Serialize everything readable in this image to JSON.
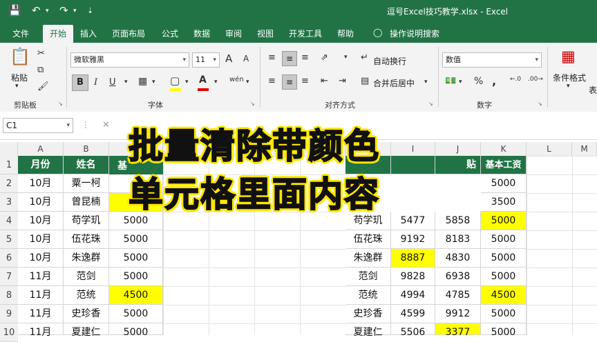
{
  "window": {
    "title": "逗号Excel技巧教学.xlsx  -  Excel"
  },
  "quick_access": {
    "save_icon": "save-icon",
    "undo_icon": "undo-icon",
    "redo_icon": "redo-icon"
  },
  "menu": {
    "items": [
      "文件",
      "开始",
      "插入",
      "页面布局",
      "公式",
      "数据",
      "审阅",
      "视图",
      "开发工具",
      "帮助"
    ],
    "active": "开始",
    "tell_me": "操作说明搜索"
  },
  "ribbon": {
    "clipboard": {
      "paste": "粘贴",
      "group": "剪贴板"
    },
    "font": {
      "name": "微软雅黑",
      "size": "11",
      "bold": "B",
      "italic": "I",
      "underline": "U",
      "group": "字体",
      "grow": "A",
      "shrink": "A",
      "phonetic": "wén",
      "font_color_mark": "A"
    },
    "alignment": {
      "wrap": "自动换行",
      "merge": "合并后居中",
      "group": "对齐方式"
    },
    "number": {
      "format": "数值",
      "percent": "%",
      "comma": ",",
      "group": "数字"
    },
    "styles": {
      "conditional": "条件格式",
      "cut_label": "表"
    }
  },
  "formula_bar": {
    "name_box": "C1",
    "cancel": "✕"
  },
  "columns": [
    "A",
    "B",
    "C",
    "D",
    "E",
    "F",
    "G",
    "H",
    "I",
    "J",
    "K",
    "L",
    "M"
  ],
  "rows": [
    "1",
    "2",
    "3",
    "4",
    "5",
    "6",
    "7",
    "8",
    "9",
    "10"
  ],
  "left_table": {
    "headers": [
      "月份",
      "姓名",
      "基"
    ],
    "rows": [
      [
        "10月",
        "粟一柯",
        ""
      ],
      [
        "10月",
        "曾昆楠",
        ""
      ],
      [
        "10月",
        "苟学玑",
        "5000"
      ],
      [
        "10月",
        "伍花珠",
        "5000"
      ],
      [
        "10月",
        "朱逸群",
        "5000"
      ],
      [
        "11月",
        "范剑",
        "5000"
      ],
      [
        "11月",
        "范统",
        "4500"
      ],
      [
        "11月",
        "史珍香",
        "5000"
      ],
      [
        "11月",
        "夏建仁",
        "5000"
      ]
    ]
  },
  "right_table": {
    "headers": [
      "",
      "",
      "贴",
      "基本工资"
    ],
    "rows": [
      [
        "",
        "",
        "",
        "5000"
      ],
      [
        "",
        "",
        "",
        "3500"
      ],
      [
        "苟学玑",
        "5477",
        "5858",
        "5000"
      ],
      [
        "伍花珠",
        "9192",
        "8183",
        "5000"
      ],
      [
        "朱逸群",
        "8887",
        "4830",
        "5000"
      ],
      [
        "范剑",
        "9828",
        "6938",
        "5000"
      ],
      [
        "范统",
        "4994",
        "4785",
        "4500"
      ],
      [
        "史珍香",
        "4599",
        "9912",
        "5000"
      ],
      [
        "夏建仁",
        "5506",
        "3377",
        "5000"
      ]
    ]
  },
  "overlay": {
    "line1": "批量清除带颜色",
    "line2": "单元格里面内容"
  }
}
